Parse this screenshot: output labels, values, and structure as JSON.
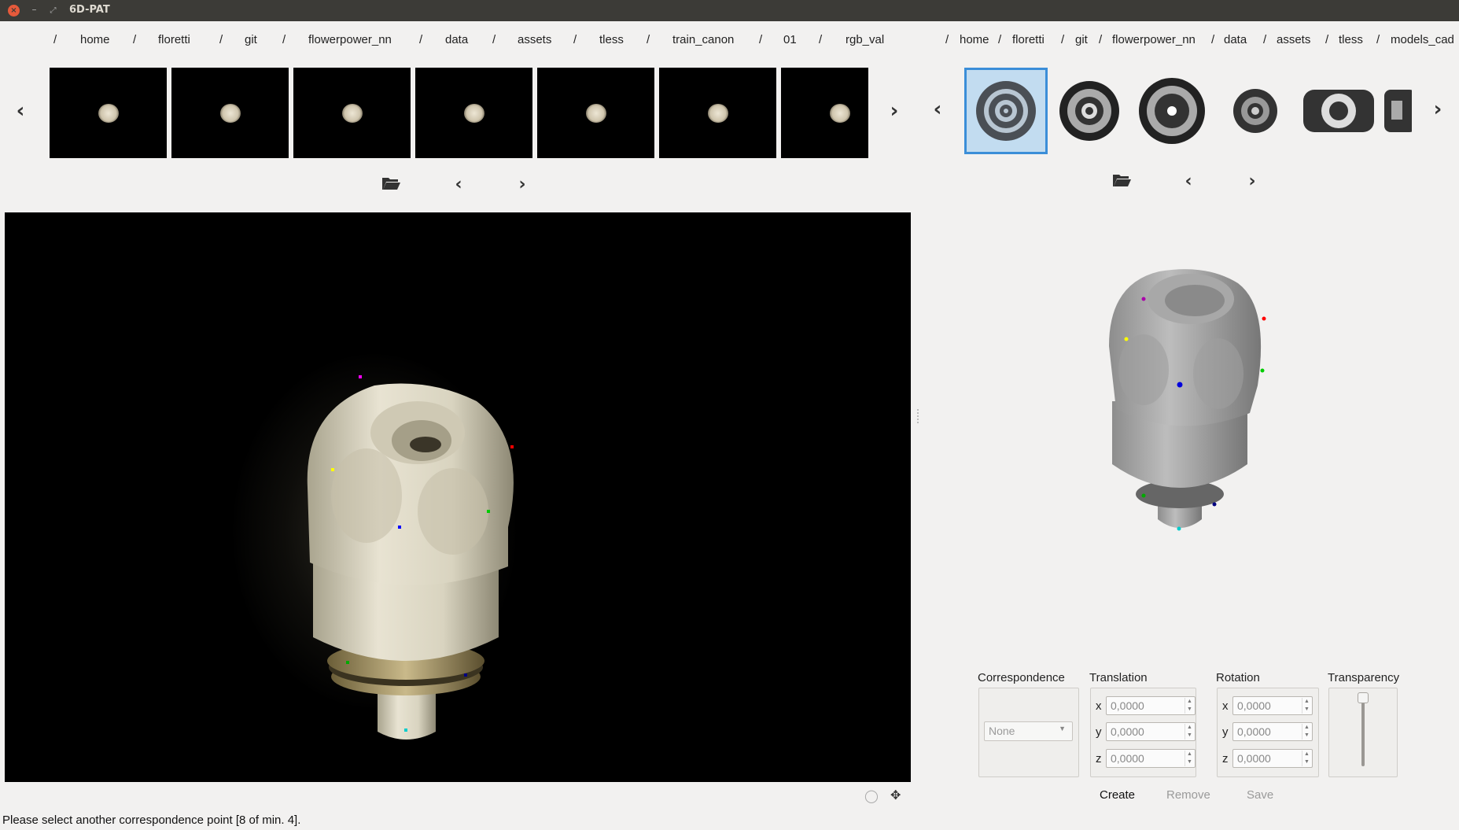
{
  "window": {
    "title": "6D-PAT"
  },
  "left_path": [
    "home",
    "floretti",
    "git",
    "flowerpower_nn",
    "data",
    "assets",
    "tless",
    "train_canon",
    "01",
    "rgb_val"
  ],
  "right_path": [
    "home",
    "floretti",
    "git",
    "flowerpower_nn",
    "data",
    "assets",
    "tless",
    "models_cad"
  ],
  "separator": "/",
  "pose_panel": {
    "correspondence_label": "Correspondence",
    "correspondence_value": "None",
    "translation_label": "Translation",
    "rotation_label": "Rotation",
    "transparency_label": "Transparency",
    "translation": {
      "x": "0,0000",
      "y": "0,0000",
      "z": "0,0000"
    },
    "rotation": {
      "x": "0,0000",
      "y": "0,0000",
      "z": "0,0000"
    },
    "axis_labels": {
      "x": "x",
      "y": "y",
      "z": "z"
    },
    "transparency_level": 0.0
  },
  "actions": {
    "create": "Create",
    "remove": "Remove",
    "save": "Save"
  },
  "status": "Please select another correspondence point [8 of min. 4].",
  "colors": {
    "selection": "#3b8ed8",
    "selection_fill": "#c2dcf0",
    "close_button": "#e65a3b",
    "titlebar": "#3c3b37"
  },
  "icons": {
    "prev": "chevron-left-icon",
    "next": "chevron-right-icon",
    "open": "folder-open-icon",
    "move": "move-icon",
    "toggle": "toggle-icon"
  }
}
